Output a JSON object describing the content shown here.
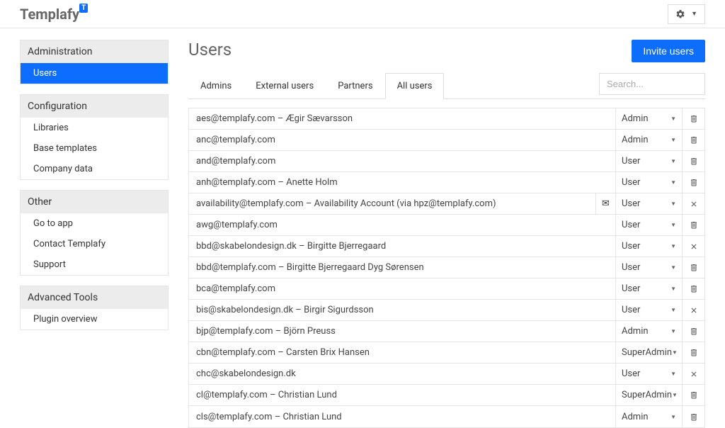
{
  "brand": {
    "name": "Templafy",
    "badge": "T"
  },
  "sidebar": {
    "sections": [
      {
        "title": "Administration",
        "items": [
          {
            "label": "Users",
            "active": true
          }
        ]
      },
      {
        "title": "Configuration",
        "items": [
          {
            "label": "Libraries",
            "active": false
          },
          {
            "label": "Base templates",
            "active": false
          },
          {
            "label": "Company data",
            "active": false
          }
        ]
      },
      {
        "title": "Other",
        "items": [
          {
            "label": "Go to app",
            "active": false
          },
          {
            "label": "Contact Templafy",
            "active": false
          },
          {
            "label": "Support",
            "active": false
          }
        ]
      },
      {
        "title": "Advanced Tools",
        "items": [
          {
            "label": "Plugin overview",
            "active": false
          }
        ]
      }
    ]
  },
  "page": {
    "title": "Users",
    "invite_label": "Invite users",
    "search_placeholder": "Search..."
  },
  "tabs": [
    {
      "label": "Admins",
      "active": false
    },
    {
      "label": "External users",
      "active": false
    },
    {
      "label": "Partners",
      "active": false
    },
    {
      "label": "All users",
      "active": true
    }
  ],
  "users": [
    {
      "display": "aes@templafy.com – Ægir Sævarsson",
      "role": "Admin",
      "action": "trash",
      "mail_icon": false
    },
    {
      "display": "anc@templafy.com",
      "role": "Admin",
      "action": "trash",
      "mail_icon": false
    },
    {
      "display": "and@templafy.com",
      "role": "User",
      "action": "trash",
      "mail_icon": false
    },
    {
      "display": "anh@templafy.com – Anette Holm",
      "role": "User",
      "action": "trash",
      "mail_icon": false
    },
    {
      "display": "availability@templafy.com – Availability Account (via hpz@templafy.com)",
      "role": "User",
      "action": "close",
      "mail_icon": true
    },
    {
      "display": "awg@templafy.com",
      "role": "User",
      "action": "trash",
      "mail_icon": false
    },
    {
      "display": "bbd@skabelondesign.dk – Birgitte Bjerregaard",
      "role": "User",
      "action": "close",
      "mail_icon": false
    },
    {
      "display": "bbd@templafy.com – Birgitte Bjerregaard Dyg Sørensen",
      "role": "User",
      "action": "trash",
      "mail_icon": false
    },
    {
      "display": "bca@templafy.com",
      "role": "User",
      "action": "trash",
      "mail_icon": false
    },
    {
      "display": "bis@skabelondesign.dk – Birgir Sigurdsson",
      "role": "User",
      "action": "close",
      "mail_icon": false
    },
    {
      "display": "bjp@templafy.com – Björn Preuss",
      "role": "Admin",
      "action": "trash",
      "mail_icon": false
    },
    {
      "display": "cbn@templafy.com – Carsten Brix Hansen",
      "role": "SuperAdmin",
      "action": "trash",
      "mail_icon": false
    },
    {
      "display": "chc@skabelondesign.dk",
      "role": "User",
      "action": "close",
      "mail_icon": false
    },
    {
      "display": "cl@templafy.com – Christian Lund",
      "role": "SuperAdmin",
      "action": "trash",
      "mail_icon": false
    },
    {
      "display": "cls@templafy.com – Christian Lund",
      "role": "Admin",
      "action": "trash",
      "mail_icon": false
    }
  ]
}
